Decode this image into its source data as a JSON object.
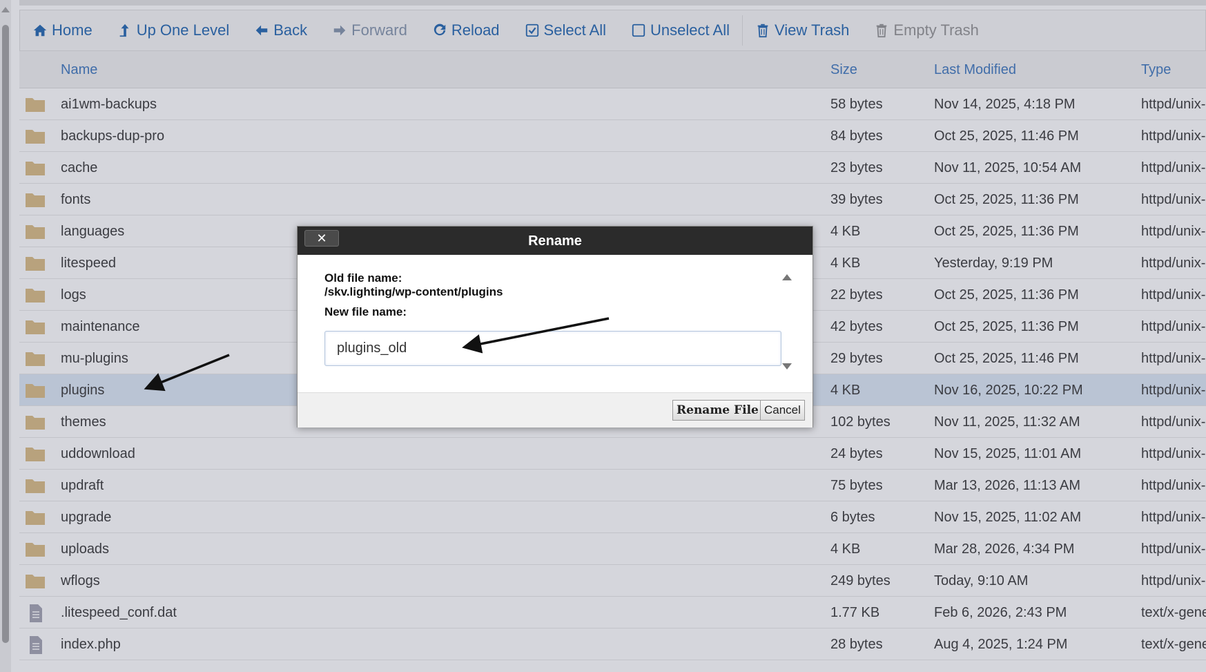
{
  "toolbar": {
    "home": "Home",
    "up": "Up One Level",
    "back": "Back",
    "forward": "Forward",
    "reload": "Reload",
    "select_all": "Select All",
    "unselect_all": "Unselect All",
    "view_trash": "View Trash",
    "empty_trash": "Empty Trash"
  },
  "columns": {
    "name": "Name",
    "size": "Size",
    "modified": "Last Modified",
    "type": "Type"
  },
  "files": [
    {
      "name": "ai1wm-backups",
      "size": "58 bytes",
      "modified": "Nov 14, 2025, 4:18 PM",
      "type": "httpd/unix-directory",
      "icon": "folder-icon"
    },
    {
      "name": "backups-dup-pro",
      "size": "84 bytes",
      "modified": "Oct 25, 2025, 11:46 PM",
      "type": "httpd/unix-directory",
      "icon": "folder-icon"
    },
    {
      "name": "cache",
      "size": "23 bytes",
      "modified": "Nov 11, 2025, 10:54 AM",
      "type": "httpd/unix-directory",
      "icon": "folder-icon"
    },
    {
      "name": "fonts",
      "size": "39 bytes",
      "modified": "Oct 25, 2025, 11:36 PM",
      "type": "httpd/unix-directory",
      "icon": "folder-icon"
    },
    {
      "name": "languages",
      "size": "4 KB",
      "modified": "Oct 25, 2025, 11:36 PM",
      "type": "httpd/unix-directory",
      "icon": "folder-icon"
    },
    {
      "name": "litespeed",
      "size": "4 KB",
      "modified": "Yesterday, 9:19 PM",
      "type": "httpd/unix-directory",
      "icon": "folder-icon"
    },
    {
      "name": "logs",
      "size": "22 bytes",
      "modified": "Oct 25, 2025, 11:36 PM",
      "type": "httpd/unix-directory",
      "icon": "folder-icon"
    },
    {
      "name": "maintenance",
      "size": "42 bytes",
      "modified": "Oct 25, 2025, 11:36 PM",
      "type": "httpd/unix-directory",
      "icon": "folder-icon"
    },
    {
      "name": "mu-plugins",
      "size": "29 bytes",
      "modified": "Oct 25, 2025, 11:46 PM",
      "type": "httpd/unix-directory",
      "icon": "folder-icon"
    },
    {
      "name": "plugins",
      "size": "4 KB",
      "modified": "Nov 16, 2025, 10:22 PM",
      "type": "httpd/unix-directory",
      "icon": "folder-icon",
      "selected": true
    },
    {
      "name": "themes",
      "size": "102 bytes",
      "modified": "Nov 11, 2025, 11:32 AM",
      "type": "httpd/unix-directory",
      "icon": "folder-icon"
    },
    {
      "name": "uddownload",
      "size": "24 bytes",
      "modified": "Nov 15, 2025, 11:01 AM",
      "type": "httpd/unix-directory",
      "icon": "folder-icon"
    },
    {
      "name": "updraft",
      "size": "75 bytes",
      "modified": "Mar 13, 2026, 11:13 AM",
      "type": "httpd/unix-directory",
      "icon": "folder-icon"
    },
    {
      "name": "upgrade",
      "size": "6 bytes",
      "modified": "Nov 15, 2025, 11:02 AM",
      "type": "httpd/unix-directory",
      "icon": "folder-icon"
    },
    {
      "name": "uploads",
      "size": "4 KB",
      "modified": "Mar 28, 2026, 4:34 PM",
      "type": "httpd/unix-directory",
      "icon": "folder-icon"
    },
    {
      "name": "wflogs",
      "size": "249 bytes",
      "modified": "Today, 9:10 AM",
      "type": "httpd/unix-directory",
      "icon": "folder-icon"
    },
    {
      "name": ".litespeed_conf.dat",
      "size": "1.77 KB",
      "modified": "Feb 6, 2026, 2:43 PM",
      "type": "text/x-generic",
      "icon": "file-icon"
    },
    {
      "name": "index.php",
      "size": "28 bytes",
      "modified": "Aug 4, 2025, 1:24 PM",
      "type": "text/x-generic",
      "icon": "file-icon"
    }
  ],
  "dialog": {
    "title": "Rename",
    "close": "✕",
    "old_label": "Old file name:",
    "old_path": "/skv.lighting/wp-content/plugins",
    "new_label": "New file name:",
    "new_value": "plugins_old",
    "rename_button": "Rename File",
    "cancel_button": "Cancel"
  },
  "colors": {
    "link": "#2f6fb5",
    "folder": "#dcc08c",
    "selected_row": "#dfe9f6",
    "dialog_header": "#2b2b2b"
  }
}
